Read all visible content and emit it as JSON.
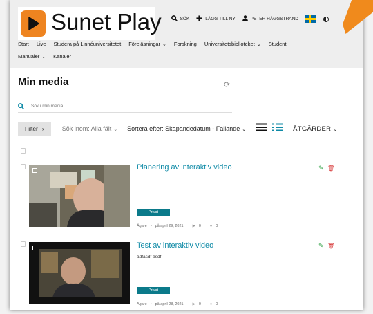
{
  "header": {
    "logo_text": "Sunet Play",
    "actions": {
      "search": "SÖK",
      "add_new": "LÄGG TILL NY",
      "user": "PETER HÄGGSTRAND"
    }
  },
  "nav": {
    "row1": [
      "Start",
      "Live",
      "Studera på Linnéuniversitetet",
      "Föreläsningar",
      "Forskning",
      "Universitetsbiblioteket",
      "Student"
    ],
    "row2": [
      "Manualer",
      "Kanaler"
    ]
  },
  "page": {
    "title": "Min media",
    "search_placeholder": "Sök i min media",
    "filter_label": "Filter",
    "search_in": "Sök inom: Alla fält",
    "sort": "Sortera efter: Skapandedatum - Fallande",
    "actions": "ÅTGÄRDER"
  },
  "items": [
    {
      "title": "Planering av interaktiv video",
      "description": "",
      "status": "Privat",
      "owner": "Ägare",
      "date": "på april 29, 2021",
      "views": "0",
      "comments": "0"
    },
    {
      "title": "Test av interaktiv video",
      "description": "adfasdf asdf",
      "status": "Privat",
      "owner": "Ägare",
      "date": "på april 28, 2021",
      "views": "0",
      "comments": "0"
    }
  ],
  "colors": {
    "accent": "#0e8aa6",
    "brand": "#ee8420",
    "badge": "#0b7a8a",
    "edit": "#2ea043",
    "delete": "#d42a2a"
  },
  "icons": [
    "play-icon",
    "search-icon",
    "plus-icon",
    "user-icon",
    "swedish-flag-icon",
    "contrast-icon",
    "refresh-icon",
    "list-view-icon",
    "detailed-view-icon",
    "edit-icon",
    "delete-icon",
    "views-icon",
    "comments-icon"
  ]
}
